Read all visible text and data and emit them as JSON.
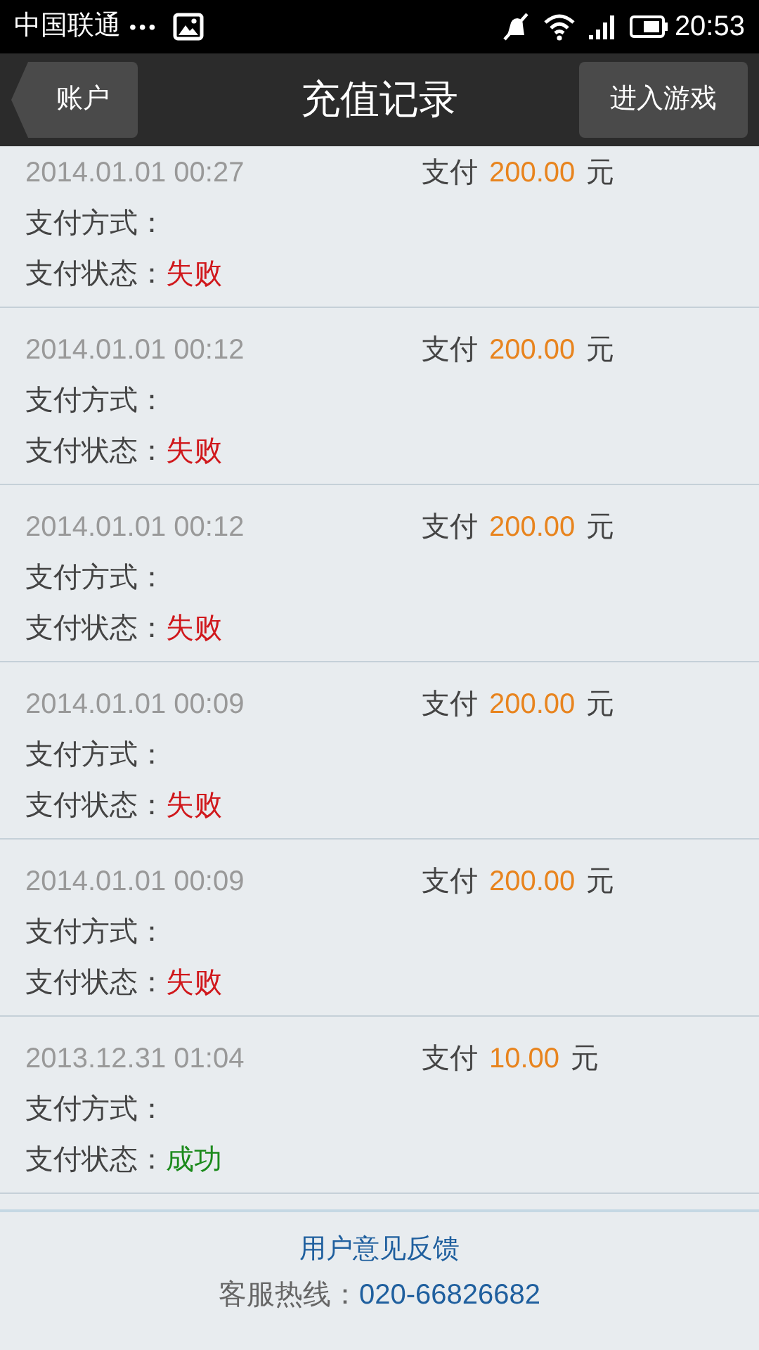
{
  "status_bar": {
    "carrier": "中国联通",
    "dots": "•••",
    "time": "20:53"
  },
  "header": {
    "back_button": "账户",
    "title": "充值记录",
    "action_button": "进入游戏"
  },
  "records": [
    {
      "date": "2014.01.01 00:27",
      "pay_label": "支付",
      "amount": "200.00",
      "unit": "元",
      "method_label": "支付方式：",
      "status_label": "支付状态：",
      "status": "失败",
      "kind": "failed"
    },
    {
      "date": "2014.01.01 00:12",
      "pay_label": "支付",
      "amount": "200.00",
      "unit": "元",
      "method_label": "支付方式：",
      "status_label": "支付状态：",
      "status": "失败",
      "kind": "failed"
    },
    {
      "date": "2014.01.01 00:12",
      "pay_label": "支付",
      "amount": "200.00",
      "unit": "元",
      "method_label": "支付方式：",
      "status_label": "支付状态：",
      "status": "失败",
      "kind": "failed"
    },
    {
      "date": "2014.01.01 00:09",
      "pay_label": "支付",
      "amount": "200.00",
      "unit": "元",
      "method_label": "支付方式：",
      "status_label": "支付状态：",
      "status": "失败",
      "kind": "failed"
    },
    {
      "date": "2014.01.01 00:09",
      "pay_label": "支付",
      "amount": "200.00",
      "unit": "元",
      "method_label": "支付方式：",
      "status_label": "支付状态：",
      "status": "失败",
      "kind": "failed"
    },
    {
      "date": "2013.12.31 01:04",
      "pay_label": "支付",
      "amount": "10.00",
      "unit": "元",
      "method_label": "支付方式：",
      "status_label": "支付状态：",
      "status": "成功",
      "kind": "success"
    }
  ],
  "footer": {
    "feedback_link": "用户意见反馈",
    "hotline_label": "客服热线：",
    "hotline_number": "020-66826682"
  }
}
